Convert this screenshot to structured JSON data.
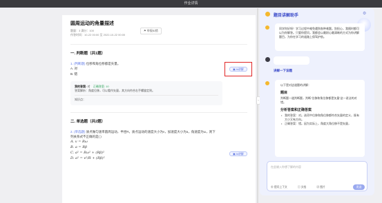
{
  "topbar": {
    "title": "作业详情"
  },
  "doc": {
    "title": "圆周运动的角量描述",
    "meta_line1": "题量：3    满分：100",
    "meta_line2": "作答时间：10-22 00:00  至  2022-10-22 00:00",
    "report_label": "举报纠错",
    "section1_title": "一. 判断题（共1题）",
    "q1_tag": "1. (判断题)",
    "q1_text": "位移和角位移都是矢量。",
    "q1_opt_a": "A. 对",
    "q1_opt_b": "B. 错",
    "ask_label": "AI讲解",
    "answer_my_label": "我的答案:",
    "answer_my_value": "对",
    "answer_correct_label": "正确答案: 10",
    "answer_note": "答案解析：角度位移，可以看作矢量，其方向符合右手螺旋定则。",
    "answer_hint": "知识点：",
    "section2_title": "二. 单选题（共2题）",
    "q2_tag": "2. (单选题)",
    "q2_text": "质点做匀速率圆周运动，半径R，质点运动的速度大小为v，加速度大小为a，角速度为ω，则下列关系式不正确的是(  )",
    "q2_opts": [
      "A. v = Rω",
      "B. a = Rβ",
      "C. a² = Rω² + (Rβ)²",
      "D. a² = v²/R + (Rβ)²"
    ]
  },
  "panel": {
    "title": "题目讲解助手",
    "intro": "同学你好呀！学习过程中难免遇到各种难题。别担心，我随时都可以为你解答。只要你提问，我都会以最耐心最清晰的方式为你讲解题目，为你在学习的道路上保驾护航。",
    "user_msg": "讲解一下该题",
    "user_label": "讲解一下该题",
    "explain_title": "以下是对这道题的讲解：",
    "h1": "题目",
    "p1": "判断题一道判断题，判断“位移和角位移都是矢量”这一说法的对错。",
    "h2": "分析答案和正确答案",
    "b1": "我的答案：对。选项中位移和角位移都符合矢量的定义，既有大小又有方向。",
    "b2": "正确答案：错。因为实际上，角度大角位移不是矢量，",
    "input_placeholder": "在此输入你想了解的内容",
    "tool1": "提问上下文",
    "tool2": "文档",
    "tool3": "图片",
    "send_label": "发送"
  }
}
